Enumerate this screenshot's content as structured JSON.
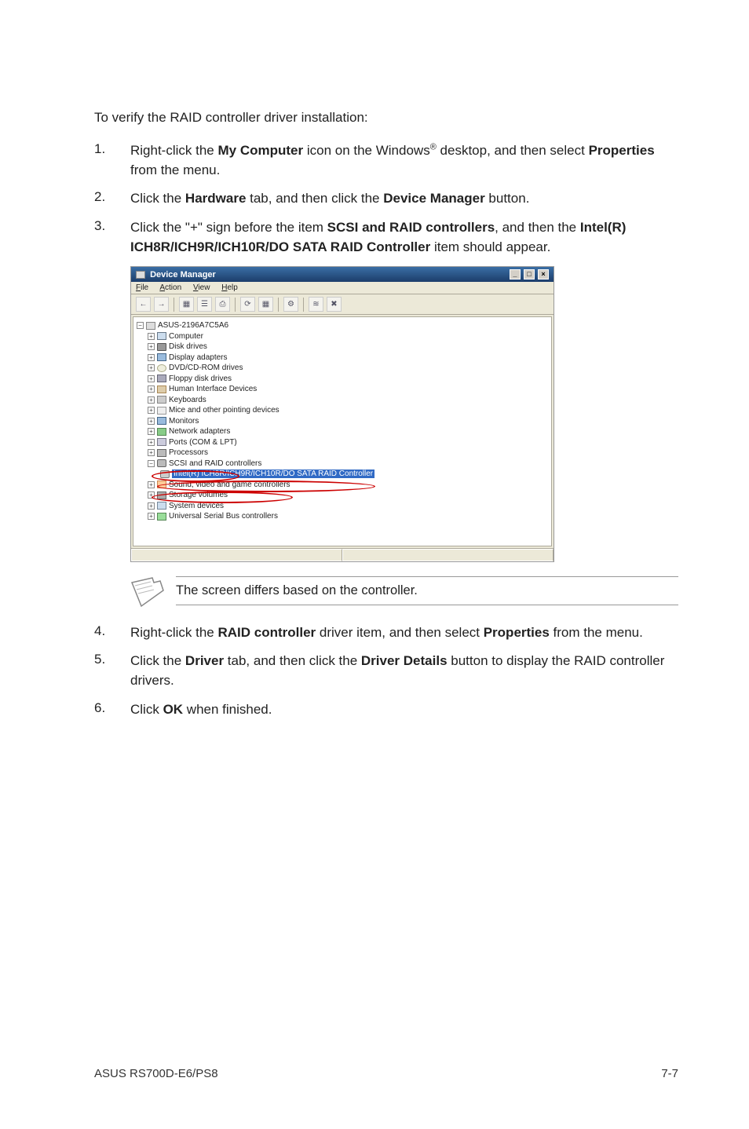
{
  "intro": "To verify the RAID controller driver installation:",
  "steps": [
    {
      "num": "1.",
      "pre": "Right-click the ",
      "b1": "My Computer",
      "mid": " icon on the Windows",
      "sup": "®",
      "post1": " desktop, and then select ",
      "b2": "Properties",
      "post2": " from the menu."
    },
    {
      "num": "2.",
      "pre": "Click the ",
      "b1": "Hardware",
      "mid": " tab, and then click the ",
      "b2": "Device Manager",
      "post": " button."
    },
    {
      "num": "3.",
      "pre": "Click the \"+\" sign before the item ",
      "b1": "SCSI and RAID controllers",
      "mid": ", and then the ",
      "b2": "Intel(R) ICH8R/ICH9R/ICH10R/DO SATA RAID Controller",
      "post": " item should appear."
    }
  ],
  "dm": {
    "title": "Device Manager",
    "menu": {
      "file": "File",
      "action": "Action",
      "view": "View",
      "help": "Help"
    },
    "root": "ASUS-2196A7C5A6",
    "nodes": [
      "Computer",
      "Disk drives",
      "Display adapters",
      "DVD/CD-ROM drives",
      "Floppy disk drives",
      "Human Interface Devices",
      "Keyboards",
      "Mice and other pointing devices",
      "Monitors",
      "Network adapters",
      "Ports (COM & LPT)",
      "Processors",
      "SCSI and RAID controllers",
      "Intel(R) ICH8R/ICH9R/ICH10R/DO SATA RAID Controller",
      "Sound, video and game controllers",
      "Storage volumes",
      "System devices",
      "Universal Serial Bus controllers"
    ]
  },
  "note": "The screen differs based on the controller.",
  "steps2": [
    {
      "num": "4.",
      "pre": "Right-click the ",
      "b1": "RAID controller",
      "mid": " driver item, and then select ",
      "b2": "Properties",
      "post": " from the menu."
    },
    {
      "num": "5.",
      "pre": "Click the ",
      "b1": "Driver",
      "mid": " tab, and then click the ",
      "b2": "Driver Details",
      "post": " button to display the RAID controller drivers."
    },
    {
      "num": "6.",
      "pre": "Click ",
      "b1": "OK",
      "post": " when finished."
    }
  ],
  "footer": {
    "left": "ASUS RS700D-E6/PS8",
    "right": "7-7"
  }
}
